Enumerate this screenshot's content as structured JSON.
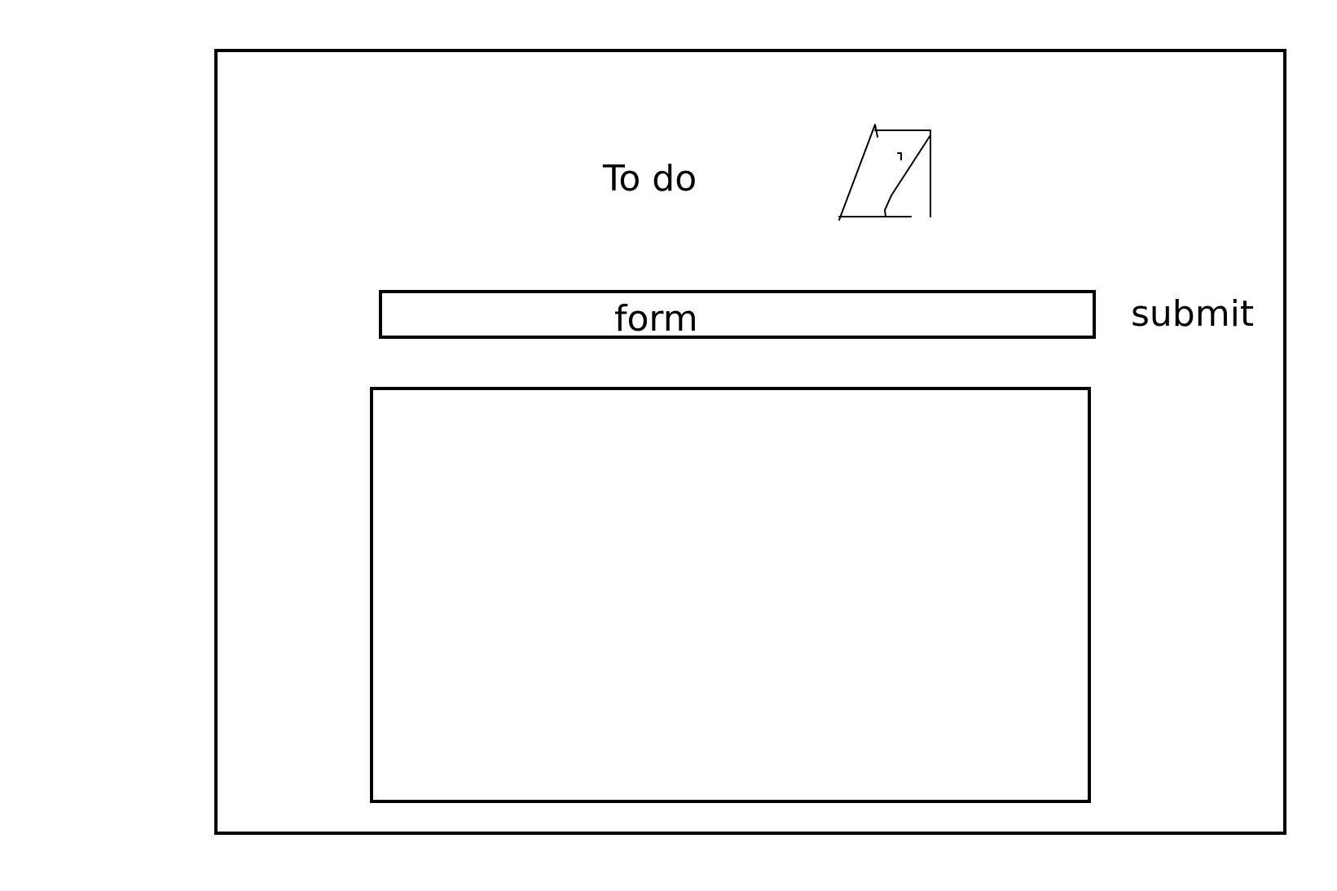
{
  "app": {
    "title": "To do"
  },
  "logo": {
    "icon": "sketch-logo-icon"
  },
  "form": {
    "placeholder": "form"
  },
  "actions": {
    "submit_label": "submit"
  },
  "todo_list": {
    "items": []
  },
  "colors": {
    "stroke": "#000000",
    "background": "#ffffff"
  }
}
